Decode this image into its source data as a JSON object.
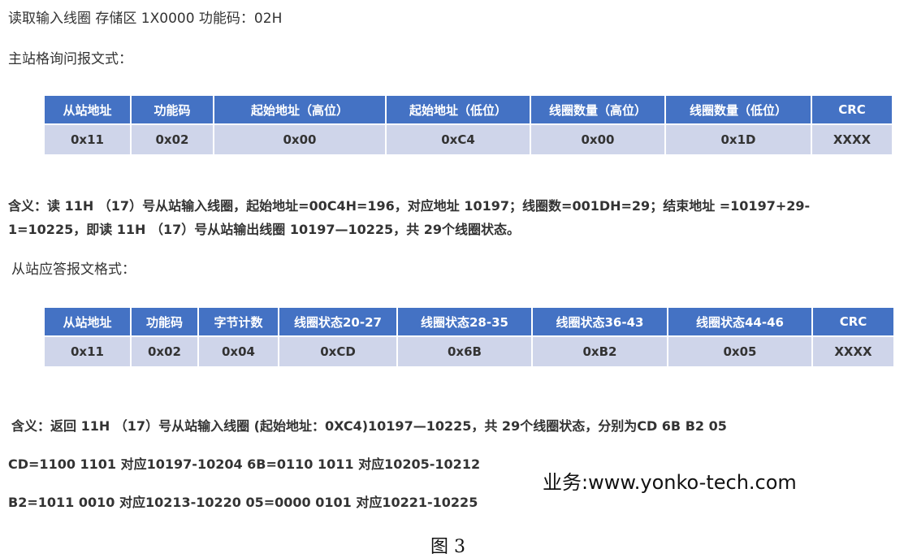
{
  "heading": {
    "line1": "读取输入线圈   存储区 1X0000  功能码：02H",
    "master_label": "主站格询问报文式："
  },
  "request_table": {
    "headers": [
      "从站地址",
      "功能码",
      "起始地址（高位）",
      "起始地址（低位）",
      "线圈数量（高位）",
      "线圈数量（低位）",
      "CRC"
    ],
    "values": [
      "0x11",
      "0x02",
      "0x00",
      "0xC4",
      "0x00",
      "0x1D",
      "XXXX"
    ]
  },
  "request_meaning": {
    "line1": "含义：读 11H （17）号从站输入线圈，起始地址=00C4H=196，对应地址 10197；线圈数=001DH=29；结束地址 =10197+29-",
    "line2": "1=10225，即读 11H （17）号从站输出线圈 10197—10225，共 29个线圈状态。"
  },
  "slave_label": "从站应答报文格式：",
  "response_table": {
    "headers": [
      "从站地址",
      "功能码",
      "字节计数",
      "线圈状态20-27",
      "线圈状态28-35",
      "线圈状态36-43",
      "线圈状态44-46",
      "CRC"
    ],
    "values": [
      "0x11",
      "0x02",
      "0x04",
      "0xCD",
      "0x6B",
      "0xB2",
      "0x05",
      "XXXX"
    ]
  },
  "response_meaning": {
    "line1": "含义：返回 11H （17）号从站输入线圈 (起始地址：0XC4)10197—10225，共 29个线圈状态，分别为CD 6B B2 05",
    "line2": "CD=1100 1101  对应10197-10204  6B=0110 1011    对应10205-10212",
    "line3": "B2=1011 0010   对应10213-10220  05=0000 0101     对应10221-10225"
  },
  "website": "业务:www.yonko-tech.com",
  "caption": "图 3",
  "colors": {
    "header_bg": "#4472c4",
    "cell_bg": "#cfd5ea",
    "text": "#333333"
  }
}
